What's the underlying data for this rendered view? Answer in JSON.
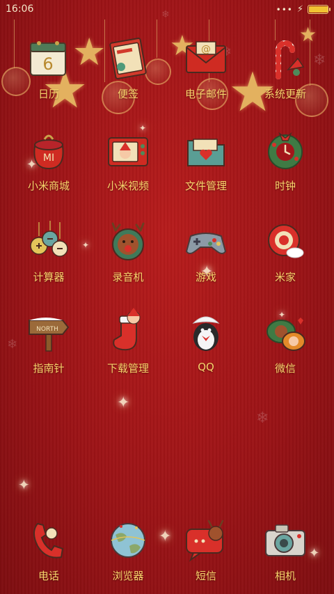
{
  "status_bar": {
    "time": "16:06",
    "battery_level": 0.95,
    "charging": true
  },
  "apps": [
    {
      "label": "日历",
      "icon": "calendar-icon",
      "badge_text": "6"
    },
    {
      "label": "便签",
      "icon": "notes-book-icon"
    },
    {
      "label": "电子邮件",
      "icon": "email-envelope-icon",
      "badge_text": "@"
    },
    {
      "label": "系统更新",
      "icon": "candy-cane-update-icon"
    },
    {
      "label": "小米商城",
      "icon": "gift-bag-mi-icon",
      "badge_text": "MI"
    },
    {
      "label": "小米视频",
      "icon": "tv-santa-icon"
    },
    {
      "label": "文件管理",
      "icon": "folder-heart-icon"
    },
    {
      "label": "时钟",
      "icon": "wreath-clock-icon"
    },
    {
      "label": "计算器",
      "icon": "ornament-calculator-icon"
    },
    {
      "label": "录音机",
      "icon": "reindeer-recorder-icon"
    },
    {
      "label": "游戏",
      "icon": "gamepad-icon"
    },
    {
      "label": "米家",
      "icon": "home-ornament-icon"
    },
    {
      "label": "指南针",
      "icon": "north-signpost-icon",
      "badge_text": "NORTH"
    },
    {
      "label": "下载管理",
      "icon": "santa-stocking-icon"
    },
    {
      "label": "QQ",
      "icon": "penguin-icon"
    },
    {
      "label": "微信",
      "icon": "chat-bubbles-icon"
    }
  ],
  "dock": [
    {
      "label": "电话",
      "icon": "phone-handset-icon"
    },
    {
      "label": "浏览器",
      "icon": "globe-browser-icon"
    },
    {
      "label": "短信",
      "icon": "message-reindeer-icon"
    },
    {
      "label": "相机",
      "icon": "camera-icon"
    }
  ],
  "colors": {
    "label": "#f7d36b",
    "background": "#a3151a",
    "gold": "#e3b15f"
  }
}
